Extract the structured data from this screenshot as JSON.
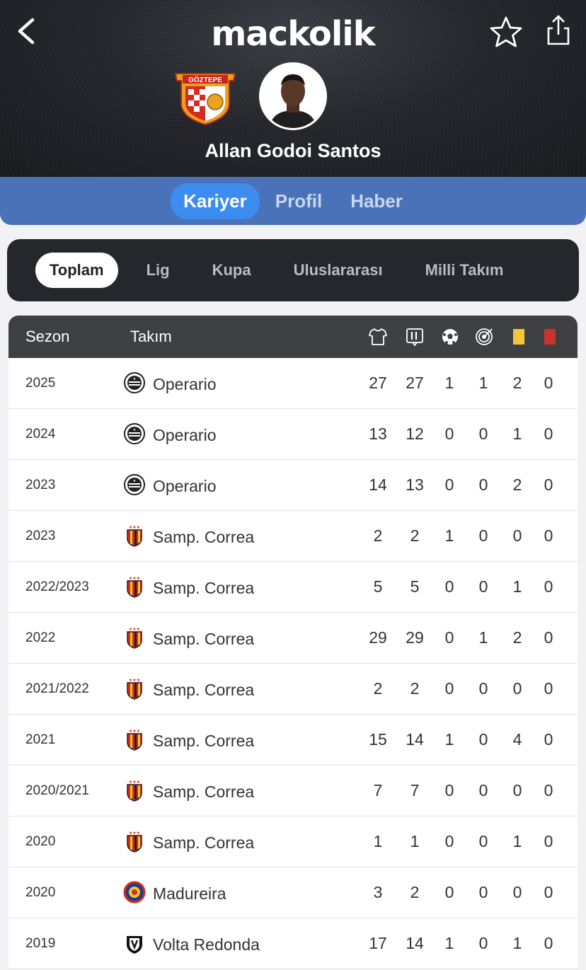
{
  "app": {
    "logo_text": "mackolik"
  },
  "player": {
    "name": "Allan Godoi Santos",
    "club_crest_text": "GÖZTEPE"
  },
  "top_tabs": [
    {
      "label": "Kariyer",
      "active": true
    },
    {
      "label": "Profil",
      "active": false
    },
    {
      "label": "Haber",
      "active": false
    }
  ],
  "filter_tabs": [
    {
      "label": "Toplam",
      "active": true
    },
    {
      "label": "Lig",
      "active": false
    },
    {
      "label": "Kupa",
      "active": false
    },
    {
      "label": "Uluslararası",
      "active": false
    },
    {
      "label": "Milli Takım",
      "active": false
    }
  ],
  "table": {
    "headers": {
      "season": "Sezon",
      "team": "Takım",
      "icons": [
        "jersey-icon",
        "lineup-eleven-icon",
        "goal-ball-icon",
        "assist-target-icon",
        "yellow-card-icon",
        "red-card-icon"
      ]
    },
    "rows": [
      {
        "season": "2025",
        "team": "Operario",
        "logo": "operario",
        "stats": [
          27,
          27,
          1,
          1,
          2,
          0
        ]
      },
      {
        "season": "2024",
        "team": "Operario",
        "logo": "operario",
        "stats": [
          13,
          12,
          0,
          0,
          1,
          0
        ]
      },
      {
        "season": "2023",
        "team": "Operario",
        "logo": "operario",
        "stats": [
          14,
          13,
          0,
          0,
          2,
          0
        ]
      },
      {
        "season": "2023",
        "team": "Samp. Correa",
        "logo": "sampaio",
        "stats": [
          2,
          2,
          1,
          0,
          0,
          0
        ]
      },
      {
        "season": "2022/2023",
        "team": "Samp. Correa",
        "logo": "sampaio",
        "stats": [
          5,
          5,
          0,
          0,
          1,
          0
        ]
      },
      {
        "season": "2022",
        "team": "Samp. Correa",
        "logo": "sampaio",
        "stats": [
          29,
          29,
          0,
          1,
          2,
          0
        ]
      },
      {
        "season": "2021/2022",
        "team": "Samp. Correa",
        "logo": "sampaio",
        "stats": [
          2,
          2,
          0,
          0,
          0,
          0
        ]
      },
      {
        "season": "2021",
        "team": "Samp. Correa",
        "logo": "sampaio",
        "stats": [
          15,
          14,
          1,
          0,
          4,
          0
        ]
      },
      {
        "season": "2020/2021",
        "team": "Samp. Correa",
        "logo": "sampaio",
        "stats": [
          7,
          7,
          0,
          0,
          0,
          0
        ]
      },
      {
        "season": "2020",
        "team": "Samp. Correa",
        "logo": "sampaio",
        "stats": [
          1,
          1,
          0,
          0,
          1,
          0
        ]
      },
      {
        "season": "2020",
        "team": "Madureira",
        "logo": "madureira",
        "stats": [
          3,
          2,
          0,
          0,
          0,
          0
        ]
      },
      {
        "season": "2019",
        "team": "Volta Redonda",
        "logo": "volta",
        "stats": [
          17,
          14,
          1,
          0,
          1,
          0
        ]
      }
    ]
  },
  "colors": {
    "header_bg": "#222327",
    "tab_bar": "#4a72b8",
    "tab_active": "#3d8cf0",
    "filter_bg": "#26272c",
    "yellow_card": "#f1c63b",
    "red_card": "#c8342d"
  }
}
